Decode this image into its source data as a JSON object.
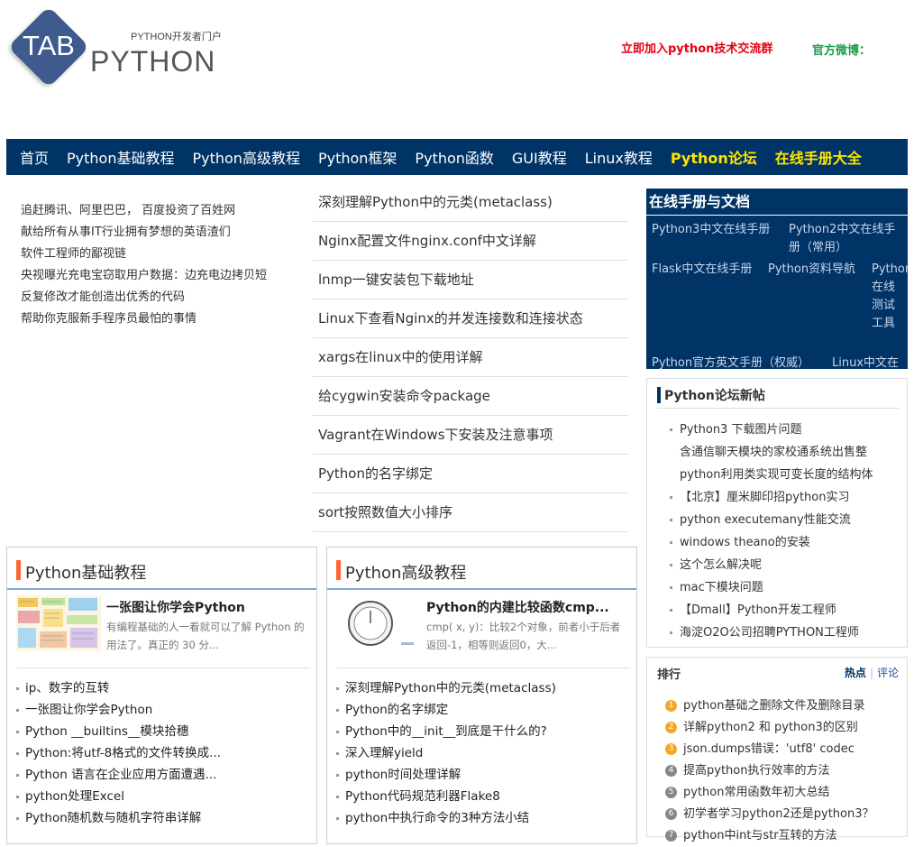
{
  "header": {
    "logo_tab": "TAB",
    "logo_subtitle": "PYTHON开发者门户",
    "logo_python": "PYTHON",
    "join_text": "立即加入python技术交流群",
    "weibo_text": "官方微博："
  },
  "nav": {
    "items": [
      {
        "label": "首页",
        "highlight": false
      },
      {
        "label": "Python基础教程",
        "highlight": false
      },
      {
        "label": "Python高级教程",
        "highlight": false
      },
      {
        "label": "Python框架",
        "highlight": false
      },
      {
        "label": "Python函数",
        "highlight": false
      },
      {
        "label": "GUI教程",
        "highlight": false
      },
      {
        "label": "Linux教程",
        "highlight": false
      },
      {
        "label": "Python论坛",
        "highlight": true
      },
      {
        "label": "在线手册大全",
        "highlight": true
      }
    ]
  },
  "left_news": [
    "追赶腾讯、阿里巴巴， 百度投资了百姓网",
    "献给所有从事IT行业拥有梦想的英语渣们",
    "软件工程师的鄙视链",
    "央视曝光充电宝窃取用户数据：边充电边拷贝短",
    "反复修改才能创造出优秀的代码",
    "帮助你克服新手程序员最怕的事情"
  ],
  "center_list": [
    "深刻理解Python中的元类(metaclass)",
    "Nginx配置文件nginx.conf中文详解",
    "lnmp一键安装包下载地址",
    "Linux下查看Nginx的并发连接数和连接状态",
    "xargs在linux中的使用详解",
    "给cygwin安装命令package",
    "Vagrant在Windows下安装及注意事项",
    "Python的名字绑定",
    "sort按照数值大小排序"
  ],
  "manual": {
    "title": "在线手册与文档",
    "links": {
      "py3": "Python3中文在线手册",
      "py2": "Python2中文在线手册（常用）",
      "flask": "Flask中文在线手册",
      "nav": "Python资料导航",
      "online_test": "Python在线测试工具",
      "official": "Python官方英文手册（权威）",
      "linux": "Linux中文在线手册"
    }
  },
  "forum": {
    "title": "Python论坛新帖",
    "items": [
      {
        "text": "Python3 下载图片问题",
        "dot": true
      },
      {
        "text": "含通信聊天模块的家校通系统出售整",
        "dot": false
      },
      {
        "text": "python利用类实现可变长度的结构体",
        "dot": false
      },
      {
        "text": "【北京】厘米脚印招python实习",
        "dot": true
      },
      {
        "text": "python executemany性能交流",
        "dot": true
      },
      {
        "text": "windows theano的安装",
        "dot": true
      },
      {
        "text": "这个怎么解决呢",
        "dot": true
      },
      {
        "text": "mac下模块问题",
        "dot": true
      },
      {
        "text": "【Dmall】Python开发工程师",
        "dot": true
      },
      {
        "text": "海淀O2O公司招聘PYTHON工程师",
        "dot": true
      }
    ]
  },
  "rank": {
    "title": "排行",
    "tab_hot": "热点",
    "tab_sep": "|",
    "tab_comment": "评论",
    "items": [
      {
        "num": "1",
        "text": "python基础之删除文件及删除目录",
        "color": "#f5a623"
      },
      {
        "num": "2",
        "text": "详解python2 和 python3的区别",
        "color": "#f5a623"
      },
      {
        "num": "3",
        "text": "json.dumps错误：'utf8' codec",
        "color": "#f5a623"
      },
      {
        "num": "4",
        "text": "提高python执行效率的方法",
        "color": "#888888"
      },
      {
        "num": "5",
        "text": "python常用函数年初大总结",
        "color": "#888888"
      },
      {
        "num": "6",
        "text": "初学者学习python2还是python3？",
        "color": "#888888"
      },
      {
        "num": "7",
        "text": "python中int与str互转的方法",
        "color": "#888888"
      }
    ]
  },
  "basic_box": {
    "title": "Python基础教程",
    "feature_title": "一张图让你学会Python",
    "feature_desc": "有编程基础的人一看就可以了解 Python 的用法了。真正的 30 分...",
    "list": [
      "ip、数字的互转",
      "一张图让你学会Python",
      "Python __builtins__模块拾穗",
      "Python:将utf-8格式的文件转换成...",
      "Python 语言在企业应用方面遭遇...",
      "python处理Excel",
      "Python随机数与随机字符串详解"
    ]
  },
  "advanced_box": {
    "title": "Python高级教程",
    "feature_title": "Python的内建比较函数cmp...",
    "feature_desc": "cmp( x, y)：比较2个对象，前者小于后者返回-1，相等则返回0，大...",
    "list": [
      "深刻理解Python中的元类(metaclass)",
      "Python的名字绑定",
      "Python中的__init__到底是干什么的?",
      "深入理解yield",
      "python时间处理详解",
      "Python代码规范利器Flake8",
      "python中执行命令的3种方法小结"
    ]
  }
}
